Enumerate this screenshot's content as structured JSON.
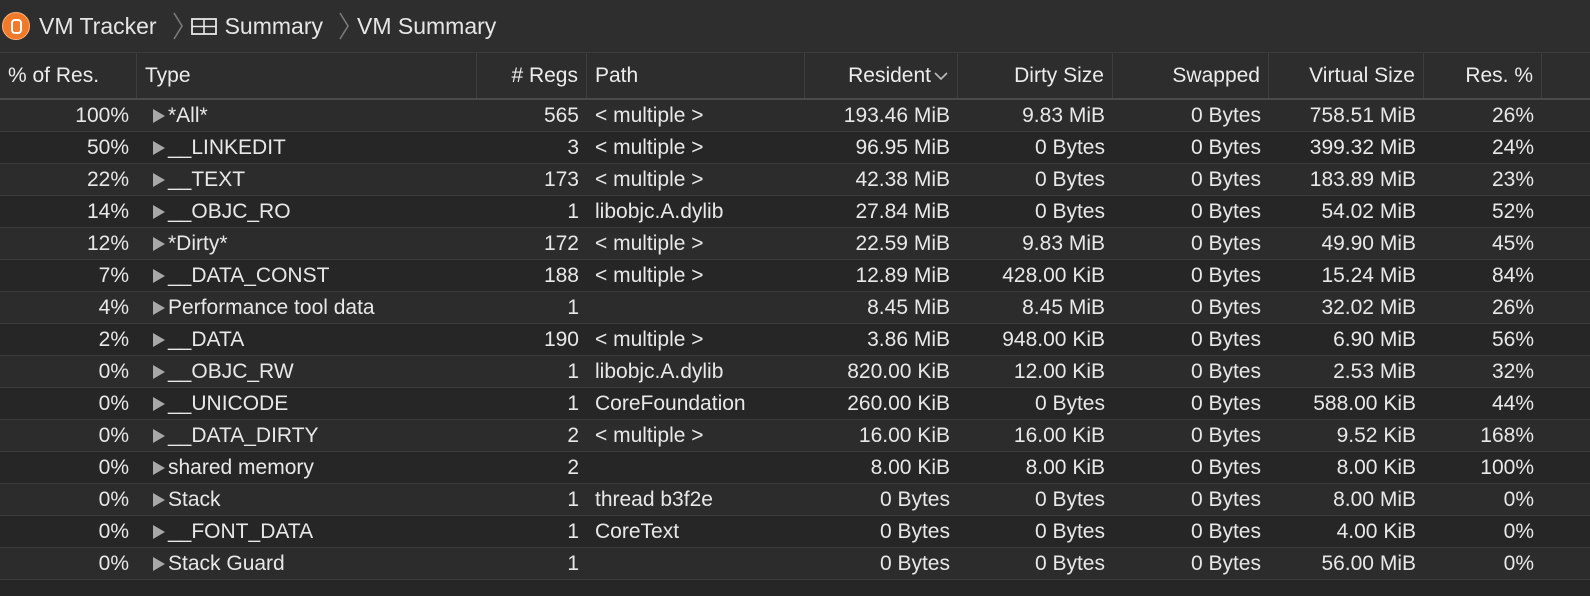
{
  "breadcrumb": {
    "items": [
      {
        "label": "VM Tracker",
        "icon": "instrument-icon"
      },
      {
        "label": "Summary",
        "icon": "table-icon"
      },
      {
        "label": "VM Summary"
      }
    ]
  },
  "table": {
    "columns": {
      "pct_res": "% of Res.",
      "type": "Type",
      "regions": "# Regs",
      "path": "Path",
      "resident": "Resident",
      "dirty": "Dirty Size",
      "swapped": "Swapped",
      "virtual": "Virtual Size",
      "res_pct": "Res. %"
    },
    "sort": {
      "column": "resident",
      "direction": "descending"
    },
    "rows": [
      {
        "pct_res": "100%",
        "type": "*All*",
        "regions": "565",
        "path": "< multiple >",
        "resident": "193.46 MiB",
        "dirty": "9.83 MiB",
        "swapped": "0 Bytes",
        "virtual": "758.51 MiB",
        "res_pct": "26%"
      },
      {
        "pct_res": "50%",
        "type": "__LINKEDIT",
        "regions": "3",
        "path": "< multiple >",
        "resident": "96.95 MiB",
        "dirty": "0 Bytes",
        "swapped": "0 Bytes",
        "virtual": "399.32 MiB",
        "res_pct": "24%"
      },
      {
        "pct_res": "22%",
        "type": "__TEXT",
        "regions": "173",
        "path": "< multiple >",
        "resident": "42.38 MiB",
        "dirty": "0 Bytes",
        "swapped": "0 Bytes",
        "virtual": "183.89 MiB",
        "res_pct": "23%"
      },
      {
        "pct_res": "14%",
        "type": "__OBJC_RO",
        "regions": "1",
        "path": "libobjc.A.dylib",
        "resident": "27.84 MiB",
        "dirty": "0 Bytes",
        "swapped": "0 Bytes",
        "virtual": "54.02 MiB",
        "res_pct": "52%"
      },
      {
        "pct_res": "12%",
        "type": "*Dirty*",
        "regions": "172",
        "path": "< multiple >",
        "resident": "22.59 MiB",
        "dirty": "9.83 MiB",
        "swapped": "0 Bytes",
        "virtual": "49.90 MiB",
        "res_pct": "45%"
      },
      {
        "pct_res": "7%",
        "type": "__DATA_CONST",
        "regions": "188",
        "path": "< multiple >",
        "resident": "12.89 MiB",
        "dirty": "428.00 KiB",
        "swapped": "0 Bytes",
        "virtual": "15.24 MiB",
        "res_pct": "84%"
      },
      {
        "pct_res": "4%",
        "type": "Performance tool data",
        "regions": "1",
        "path": "",
        "resident": "8.45 MiB",
        "dirty": "8.45 MiB",
        "swapped": "0 Bytes",
        "virtual": "32.02 MiB",
        "res_pct": "26%"
      },
      {
        "pct_res": "2%",
        "type": "__DATA",
        "regions": "190",
        "path": "< multiple >",
        "resident": "3.86 MiB",
        "dirty": "948.00 KiB",
        "swapped": "0 Bytes",
        "virtual": "6.90 MiB",
        "res_pct": "56%"
      },
      {
        "pct_res": "0%",
        "type": "__OBJC_RW",
        "regions": "1",
        "path": "libobjc.A.dylib",
        "resident": "820.00 KiB",
        "dirty": "12.00 KiB",
        "swapped": "0 Bytes",
        "virtual": "2.53 MiB",
        "res_pct": "32%"
      },
      {
        "pct_res": "0%",
        "type": "__UNICODE",
        "regions": "1",
        "path": "CoreFoundation",
        "resident": "260.00 KiB",
        "dirty": "0 Bytes",
        "swapped": "0 Bytes",
        "virtual": "588.00 KiB",
        "res_pct": "44%"
      },
      {
        "pct_res": "0%",
        "type": "__DATA_DIRTY",
        "regions": "2",
        "path": "< multiple >",
        "resident": "16.00 KiB",
        "dirty": "16.00 KiB",
        "swapped": "0 Bytes",
        "virtual": "9.52 KiB",
        "res_pct": "168%"
      },
      {
        "pct_res": "0%",
        "type": "shared memory",
        "regions": "2",
        "path": "",
        "resident": "8.00 KiB",
        "dirty": "8.00 KiB",
        "swapped": "0 Bytes",
        "virtual": "8.00 KiB",
        "res_pct": "100%"
      },
      {
        "pct_res": "0%",
        "type": "Stack",
        "regions": "1",
        "path": "thread b3f2e",
        "resident": "0 Bytes",
        "dirty": "0 Bytes",
        "swapped": "0 Bytes",
        "virtual": "8.00 MiB",
        "res_pct": "0%"
      },
      {
        "pct_res": "0%",
        "type": "__FONT_DATA",
        "regions": "1",
        "path": "CoreText",
        "resident": "0 Bytes",
        "dirty": "0 Bytes",
        "swapped": "0 Bytes",
        "virtual": "4.00 KiB",
        "res_pct": "0%"
      },
      {
        "pct_res": "0%",
        "type": "Stack Guard",
        "regions": "1",
        "path": "",
        "resident": "0 Bytes",
        "dirty": "0 Bytes",
        "swapped": "0 Bytes",
        "virtual": "56.00 MiB",
        "res_pct": "0%"
      }
    ]
  },
  "colors": {
    "background": "#262626",
    "row_alt": "#2c2c2c",
    "text": "#e8e8e8",
    "instrument_icon": "#f0792a"
  }
}
